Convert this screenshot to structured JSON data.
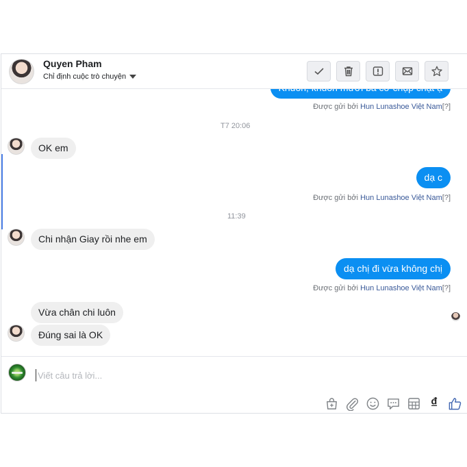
{
  "header": {
    "name": "Quyen Pham",
    "subtitle": "Chỉ định cuộc trò chuyện",
    "actions": [
      "check-icon",
      "trash-icon",
      "spam-icon",
      "mail-icon",
      "star-icon"
    ]
  },
  "messages": {
    "first_partial": "Khuôn, khuôn mười ba cỡ chụp chặt ạ",
    "sent_prefix": "Được gửi bởi",
    "sent_by": "Hun Lunashoe Việt Nam",
    "sent_suffix": "[?]",
    "time1": "T7 20:06",
    "in1": "OK em",
    "out1": "dạ c",
    "time2": "11:39",
    "in2": "Chi nhận Giay rồi nhe em",
    "out2": "dạ chị đi vừa không chị",
    "in3": "Vừa chân chi luôn",
    "in4": "Đúng sai là OK"
  },
  "composer": {
    "placeholder": "Viết câu trả lời...",
    "currency_symbol": "₫",
    "tools": [
      "shopping-bag-icon",
      "attachment-icon",
      "emoji-icon",
      "saved-reply-icon",
      "table-icon",
      "currency-icon",
      "like-icon"
    ]
  },
  "colors": {
    "outgoing": "#0b8ff2",
    "incoming": "#efefef",
    "link": "#385898",
    "like": "#4267b2"
  }
}
